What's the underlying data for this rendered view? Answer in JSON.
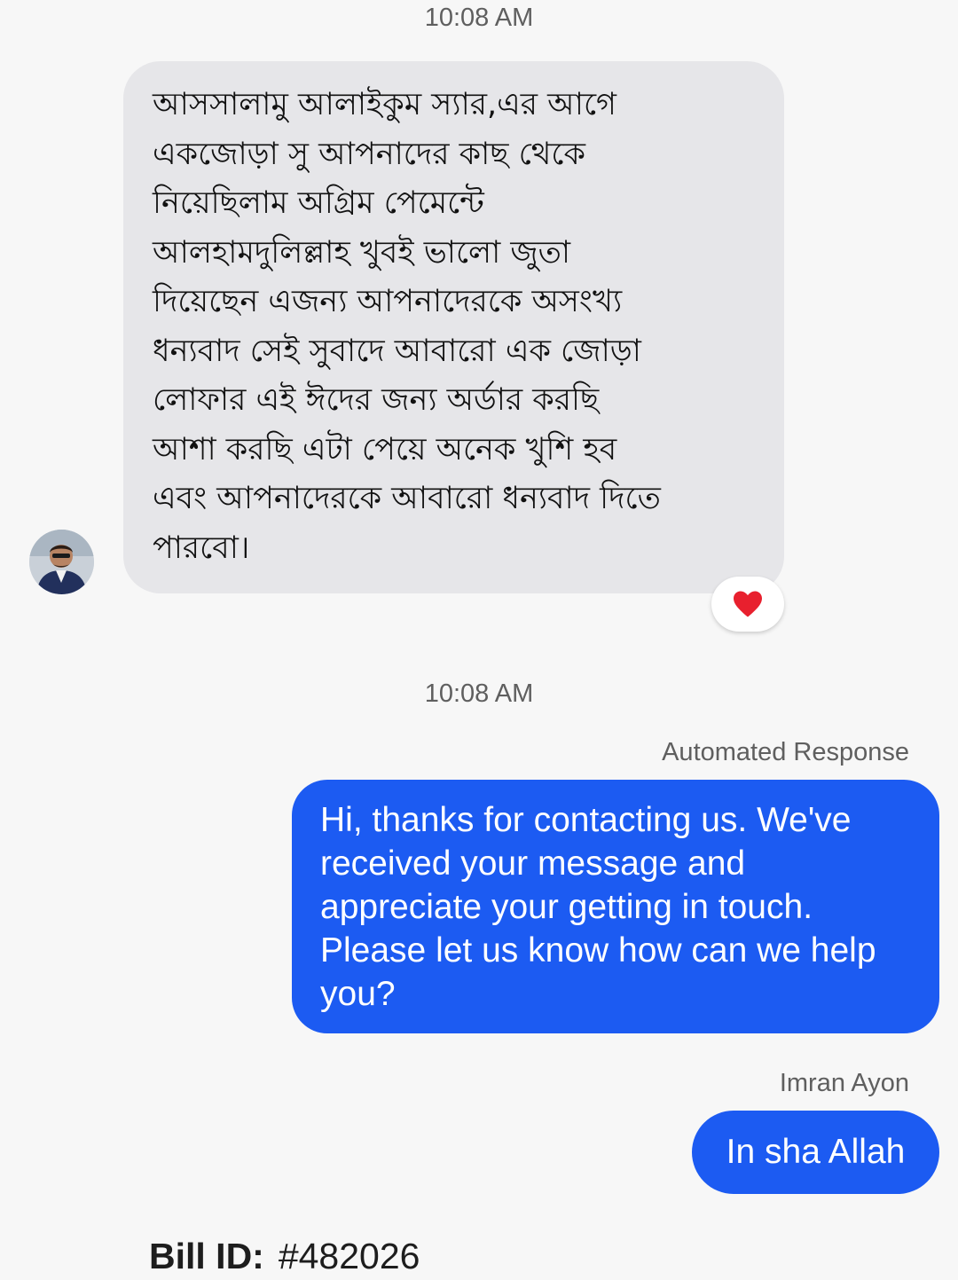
{
  "conversation": {
    "timestamps": [
      "10:08 AM",
      "10:08 AM"
    ],
    "incoming_message": {
      "text": "আসসালামু আলাইকুম স্যার,এর আগে\nএকজোড়া সু আপনাদের কাছ থেকে\nনিয়েছিলাম অগ্রিম পেমেন্টে\nআলহামদুলিল্লাহ খুবই ভালো জুতা\nদিয়েছেন এজন্য আপনাদেরকে অসংখ্য\nধন্যবাদ সেই সুবাদে আবারো এক জোড়া\nলোফার এই ঈদের জন্য অর্ডার করছি\nআশা করছি এটা পেয়ে অনেক খুশি হব\nএবং আপনাদেরকে আবারো ধন্যবাদ দিতে\nপারবো।",
      "reaction_icon": "heart-icon",
      "reaction_color": "#e8202e",
      "avatar_icon": "avatar"
    },
    "outgoing_messages": [
      {
        "sender_label": "Automated Response",
        "text": "Hi, thanks for contacting us. We've\nreceived your message and\nappreciate your getting in touch.\nPlease let us know how can we help\nyou?"
      },
      {
        "sender_label": "Imran Ayon",
        "text": "In sha Allah"
      }
    ],
    "bill": {
      "label": "Bill ID:",
      "value": "#482026"
    }
  },
  "colors": {
    "background": "#f7f7f7",
    "incoming_bubble": "#e6e6e9",
    "outgoing_bubble": "#1c5bf2",
    "timestamp_text": "#5f5f5f"
  }
}
